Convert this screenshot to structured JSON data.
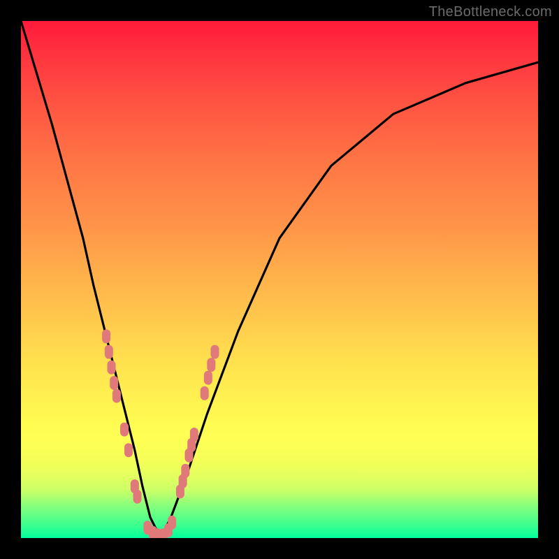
{
  "watermark": "TheBottleneck.com",
  "colors": {
    "background": "#000000",
    "curve": "#000000",
    "markers": "#e07a7a",
    "gradient_top": "#ff1a3a",
    "gradient_bottom": "#00ff9c"
  },
  "chart_data": {
    "type": "line",
    "title": "",
    "xlabel": "",
    "ylabel": "",
    "xlim": [
      0,
      100
    ],
    "ylim": [
      0,
      100
    ],
    "grid": false,
    "background_gradient": "red-yellow-green (bottleneck heatmap)",
    "series": [
      {
        "name": "bottleneck-curve",
        "x": [
          0,
          3,
          6,
          9,
          12,
          14,
          16,
          18,
          20,
          22,
          23.5,
          25,
          27,
          29,
          32,
          36,
          42,
          50,
          60,
          72,
          86,
          100
        ],
        "values": [
          100,
          90,
          80,
          69,
          58,
          49,
          41,
          33,
          25,
          17,
          10,
          4,
          0,
          4,
          12,
          24,
          40,
          58,
          72,
          82,
          88,
          92
        ]
      }
    ],
    "markers": {
      "name": "highlighted-range",
      "points": [
        {
          "x": 16.5,
          "y": 39
        },
        {
          "x": 17.0,
          "y": 36
        },
        {
          "x": 17.5,
          "y": 33
        },
        {
          "x": 18.0,
          "y": 30
        },
        {
          "x": 18.5,
          "y": 27.5
        },
        {
          "x": 20.0,
          "y": 21
        },
        {
          "x": 20.8,
          "y": 17
        },
        {
          "x": 22.0,
          "y": 10
        },
        {
          "x": 22.5,
          "y": 8
        },
        {
          "x": 24.5,
          "y": 2
        },
        {
          "x": 25.5,
          "y": 1
        },
        {
          "x": 26.5,
          "y": 0.5
        },
        {
          "x": 27.5,
          "y": 0.5
        },
        {
          "x": 28.5,
          "y": 1.5
        },
        {
          "x": 29.2,
          "y": 3
        },
        {
          "x": 30.8,
          "y": 9
        },
        {
          "x": 31.3,
          "y": 11
        },
        {
          "x": 31.8,
          "y": 13
        },
        {
          "x": 32.5,
          "y": 16
        },
        {
          "x": 33.0,
          "y": 18
        },
        {
          "x": 33.5,
          "y": 20
        },
        {
          "x": 35.5,
          "y": 28
        },
        {
          "x": 36.2,
          "y": 31
        },
        {
          "x": 36.8,
          "y": 33.5
        },
        {
          "x": 37.5,
          "y": 36
        }
      ]
    }
  }
}
